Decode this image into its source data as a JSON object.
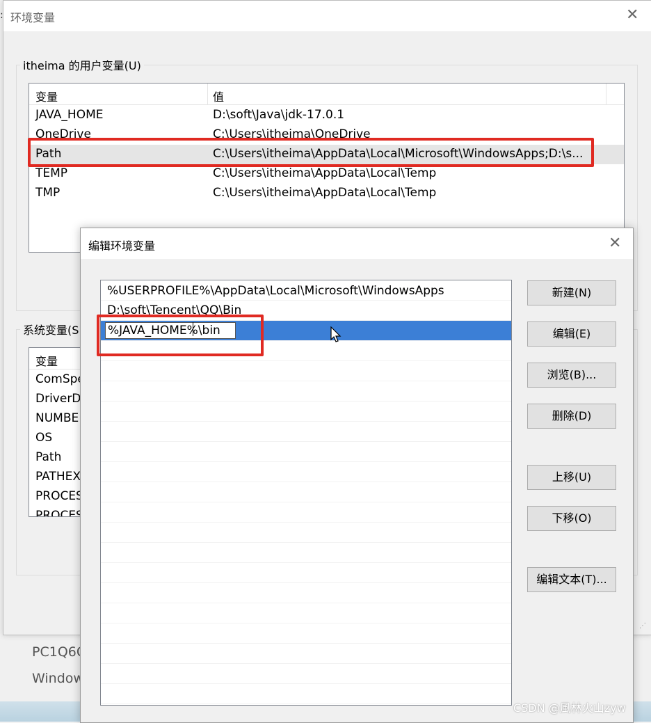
{
  "outer_window": {
    "title": "环境变量",
    "user_group_label": "itheima 的用户变量(U)",
    "system_group_label": "系统变量(S",
    "user_vars": {
      "headers": [
        "变量",
        "值"
      ],
      "rows": [
        {
          "name": "JAVA_HOME",
          "value": "D:\\soft\\Java\\jdk-17.0.1"
        },
        {
          "name": "OneDrive",
          "value": "C:\\Users\\itheima\\OneDrive"
        },
        {
          "name": "Path",
          "value": "C:\\Users\\itheima\\AppData\\Local\\Microsoft\\WindowsApps;D:\\s..."
        },
        {
          "name": "TEMP",
          "value": "C:\\Users\\itheima\\AppData\\Local\\Temp"
        },
        {
          "name": "TMP",
          "value": "C:\\Users\\itheima\\AppData\\Local\\Temp"
        }
      ],
      "selected_index": 2
    },
    "system_vars": {
      "header": "变量",
      "rows": [
        "ComSpe",
        "DriverD",
        "NUMBE",
        "OS",
        "Path",
        "PATHEX",
        "PROCES",
        "PROCES"
      ]
    }
  },
  "background_text": {
    "line1": "PC1Q6C",
    "line2": "Window"
  },
  "edit_dialog": {
    "title": "编辑环境变量",
    "entries": [
      "%USERPROFILE%\\AppData\\Local\\Microsoft\\WindowsApps",
      "D:\\soft\\Tencent\\QQ\\Bin"
    ],
    "editing_value": "%JAVA_HOME%\\bin",
    "buttons": {
      "new": "新建(N)",
      "edit": "编辑(E)",
      "browse": "浏览(B)...",
      "delete": "删除(D)",
      "move_up": "上移(U)",
      "move_down": "下移(O)",
      "edit_text": "编辑文本(T)..."
    }
  },
  "watermark": "CSDN @風林火山zyw",
  "colors": {
    "highlight": "#e02a22",
    "selection_blue": "#3c7fd6"
  }
}
